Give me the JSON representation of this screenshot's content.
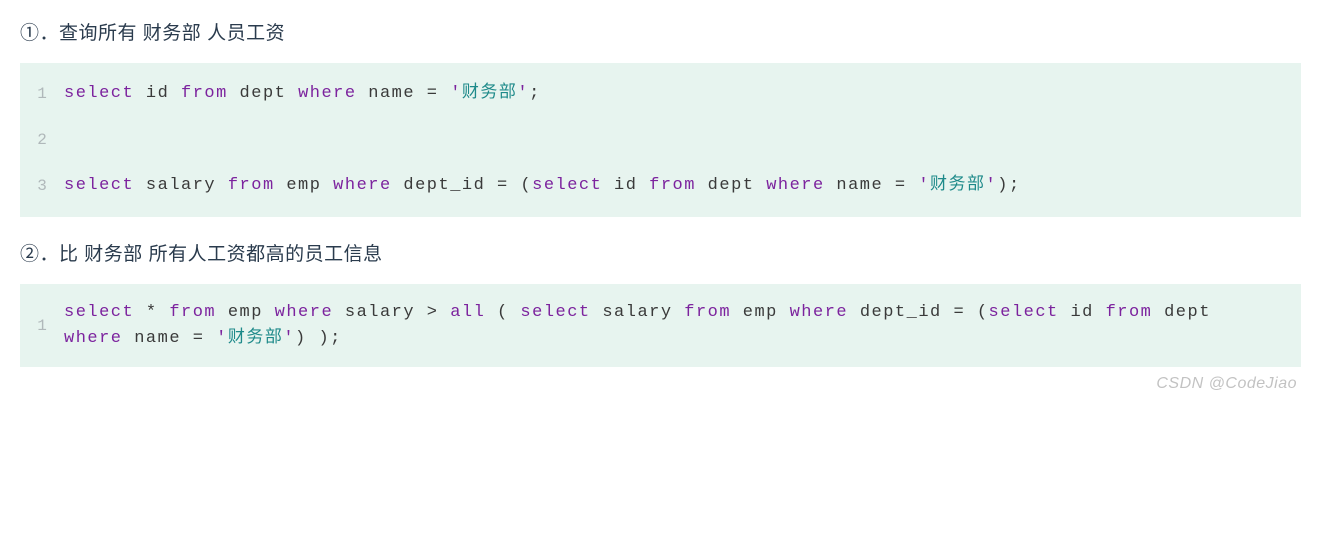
{
  "sections": [
    {
      "heading_prefix": "①．查询所有 ",
      "heading_bold": "财务部",
      "heading_suffix": " 人员工资",
      "code": {
        "lines": [
          {
            "num": "1",
            "tokens": [
              {
                "t": "select",
                "c": "kw"
              },
              {
                "t": " ",
                "c": "id"
              },
              {
                "t": "id",
                "c": "id"
              },
              {
                "t": " ",
                "c": "id"
              },
              {
                "t": "from",
                "c": "kw"
              },
              {
                "t": " ",
                "c": "id"
              },
              {
                "t": "dept",
                "c": "id"
              },
              {
                "t": " ",
                "c": "id"
              },
              {
                "t": "where",
                "c": "kw"
              },
              {
                "t": " ",
                "c": "id"
              },
              {
                "t": "name",
                "c": "id"
              },
              {
                "t": " ",
                "c": "id"
              },
              {
                "t": "=",
                "c": "id"
              },
              {
                "t": " ",
                "c": "id"
              },
              {
                "t": "'",
                "c": "strq"
              },
              {
                "t": "财务部",
                "c": "str"
              },
              {
                "t": "'",
                "c": "strq"
              },
              {
                "t": ";",
                "c": "id"
              }
            ]
          },
          {
            "num": "2",
            "tokens": []
          },
          {
            "num": "3",
            "tokens": [
              {
                "t": "select",
                "c": "kw"
              },
              {
                "t": " ",
                "c": "id"
              },
              {
                "t": "salary",
                "c": "id"
              },
              {
                "t": " ",
                "c": "id"
              },
              {
                "t": "from",
                "c": "kw"
              },
              {
                "t": " ",
                "c": "id"
              },
              {
                "t": "emp",
                "c": "id"
              },
              {
                "t": " ",
                "c": "id"
              },
              {
                "t": "where",
                "c": "kw"
              },
              {
                "t": " ",
                "c": "id"
              },
              {
                "t": "dept_id",
                "c": "id"
              },
              {
                "t": " ",
                "c": "id"
              },
              {
                "t": "=",
                "c": "id"
              },
              {
                "t": " ",
                "c": "id"
              },
              {
                "t": "(",
                "c": "id"
              },
              {
                "t": "select",
                "c": "kw"
              },
              {
                "t": " ",
                "c": "id"
              },
              {
                "t": "id",
                "c": "id"
              },
              {
                "t": " ",
                "c": "id"
              },
              {
                "t": "from",
                "c": "kw"
              },
              {
                "t": " ",
                "c": "id"
              },
              {
                "t": "dept",
                "c": "id"
              },
              {
                "t": " ",
                "c": "id"
              },
              {
                "t": "where",
                "c": "kw"
              },
              {
                "t": " ",
                "c": "id"
              },
              {
                "t": "name",
                "c": "id"
              },
              {
                "t": " ",
                "c": "id"
              },
              {
                "t": "=",
                "c": "id"
              },
              {
                "t": " ",
                "c": "id"
              },
              {
                "t": "'",
                "c": "strq"
              },
              {
                "t": "财务部",
                "c": "str"
              },
              {
                "t": "'",
                "c": "strq"
              },
              {
                "t": ")",
                "c": "id"
              },
              {
                "t": ";",
                "c": "id"
              }
            ]
          }
        ]
      }
    },
    {
      "heading_prefix": "②．比 ",
      "heading_bold": "财务部",
      "heading_suffix": " 所有人工资都高的员工信息",
      "code": {
        "lines": [
          {
            "num": "1",
            "tokens": [
              {
                "t": "select",
                "c": "kw"
              },
              {
                "t": " ",
                "c": "id"
              },
              {
                "t": "*",
                "c": "id"
              },
              {
                "t": " ",
                "c": "id"
              },
              {
                "t": "from",
                "c": "kw"
              },
              {
                "t": " ",
                "c": "id"
              },
              {
                "t": "emp",
                "c": "id"
              },
              {
                "t": " ",
                "c": "id"
              },
              {
                "t": "where",
                "c": "kw"
              },
              {
                "t": " ",
                "c": "id"
              },
              {
                "t": "salary",
                "c": "id"
              },
              {
                "t": " ",
                "c": "id"
              },
              {
                "t": ">",
                "c": "id"
              },
              {
                "t": " ",
                "c": "id"
              },
              {
                "t": "all",
                "c": "kw"
              },
              {
                "t": " ",
                "c": "id"
              },
              {
                "t": "(",
                "c": "id"
              },
              {
                "t": " ",
                "c": "id"
              },
              {
                "t": "select",
                "c": "kw"
              },
              {
                "t": " ",
                "c": "id"
              },
              {
                "t": "salary",
                "c": "id"
              },
              {
                "t": " ",
                "c": "id"
              },
              {
                "t": "from",
                "c": "kw"
              },
              {
                "t": " ",
                "c": "id"
              },
              {
                "t": "emp",
                "c": "id"
              },
              {
                "t": " ",
                "c": "id"
              },
              {
                "t": "where",
                "c": "kw"
              },
              {
                "t": " ",
                "c": "id"
              },
              {
                "t": "dept_id",
                "c": "id"
              },
              {
                "t": " ",
                "c": "id"
              },
              {
                "t": "=",
                "c": "id"
              },
              {
                "t": " ",
                "c": "id"
              },
              {
                "t": "(",
                "c": "id"
              },
              {
                "t": "select",
                "c": "kw"
              },
              {
                "t": " ",
                "c": "id"
              },
              {
                "t": "id",
                "c": "id"
              },
              {
                "t": " ",
                "c": "id"
              },
              {
                "t": "from",
                "c": "kw"
              },
              {
                "t": " ",
                "c": "id"
              },
              {
                "t": "dept",
                "c": "id"
              },
              {
                "t": " ",
                "c": "id"
              },
              {
                "t": "where",
                "c": "kw"
              },
              {
                "t": " ",
                "c": "id"
              },
              {
                "t": "name",
                "c": "id"
              },
              {
                "t": " ",
                "c": "id"
              },
              {
                "t": "=",
                "c": "id"
              },
              {
                "t": " ",
                "c": "id"
              },
              {
                "t": "'",
                "c": "strq"
              },
              {
                "t": "财务部",
                "c": "str"
              },
              {
                "t": "'",
                "c": "strq"
              },
              {
                "t": ")",
                "c": "id"
              },
              {
                "t": " ",
                "c": "id"
              },
              {
                "t": ")",
                "c": "id"
              },
              {
                "t": ";",
                "c": "id"
              }
            ]
          }
        ]
      }
    }
  ],
  "watermark": "CSDN @CodeJiao"
}
